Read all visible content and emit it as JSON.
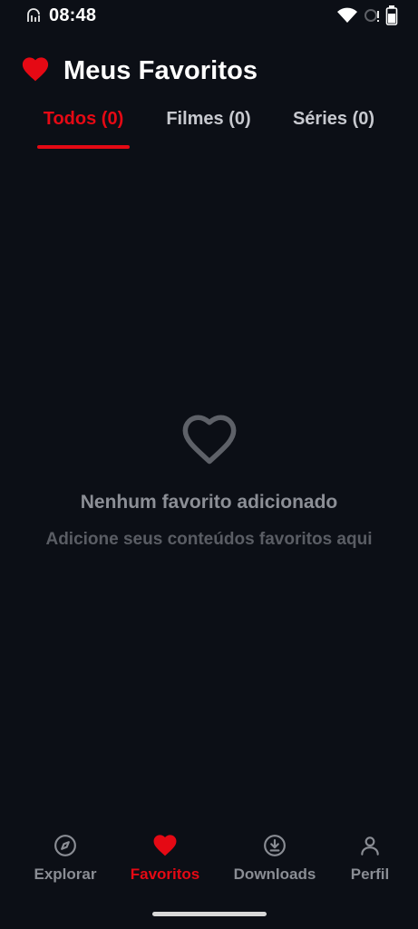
{
  "status_bar": {
    "time": "08:48",
    "icons": [
      "signal-icon",
      "wifi-icon",
      "data-sync-icon",
      "battery-icon"
    ]
  },
  "header": {
    "title": "Meus Favoritos",
    "icon": "heart-icon",
    "accent_color": "#e50914"
  },
  "tabs": [
    {
      "label": "Todos (0)",
      "active": true
    },
    {
      "label": "Filmes (0)",
      "active": false
    },
    {
      "label": "Séries (0)",
      "active": false
    }
  ],
  "empty_state": {
    "icon": "heart-outline-icon",
    "title": "Nenhum favorito adicionado",
    "subtitle": "Adicione seus conteúdos favoritos aqui"
  },
  "bottom_nav": [
    {
      "label": "Explorar",
      "icon": "compass-icon",
      "active": false
    },
    {
      "label": "Favoritos",
      "icon": "heart-icon",
      "active": true
    },
    {
      "label": "Downloads",
      "icon": "download-icon",
      "active": false
    },
    {
      "label": "Perfil",
      "icon": "user-icon",
      "active": false
    }
  ],
  "colors": {
    "background": "#0c0f16",
    "accent": "#e50914",
    "inactive": "#8a8d94"
  }
}
